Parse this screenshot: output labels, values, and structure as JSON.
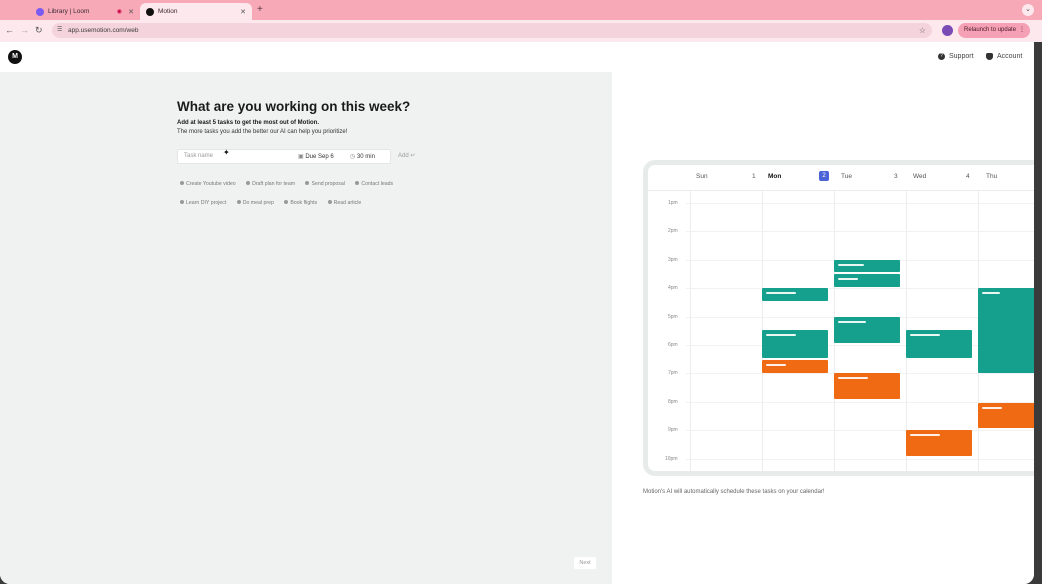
{
  "browser": {
    "tabs": [
      {
        "title": "Library | Loom",
        "active": false
      },
      {
        "title": "Motion",
        "active": true
      }
    ],
    "url": "app.usemotion.com/web",
    "update_label": "Relaunch to update",
    "accent": "#f7a9b8"
  },
  "header": {
    "logo": "M",
    "support_label": "Support",
    "account_label": "Account"
  },
  "onboarding": {
    "title": "What are you working on this week?",
    "subtitle_bold": "Add at least 5 tasks to get the most out of Motion.",
    "subtitle": "The more tasks you add the better our AI can help you prioritize!",
    "task_placeholder": "Task name",
    "due_label": "Due Sep 6",
    "duration_label": "30 min",
    "add_label": "Add",
    "suggestions": [
      "Create Youtube video",
      "Draft plan for team",
      "Send proposal",
      "Contact leads",
      "Learn DIY project",
      "Do meal prep",
      "Book flights",
      "Read article"
    ],
    "next_label": "Next"
  },
  "calendar": {
    "days": [
      {
        "name": "Sun",
        "num": "1",
        "today": false
      },
      {
        "name": "Mon",
        "num": "2",
        "today": true
      },
      {
        "name": "Tue",
        "num": "3",
        "today": false
      },
      {
        "name": "Wed",
        "num": "4",
        "today": false
      },
      {
        "name": "Thu",
        "num": "",
        "today": false
      }
    ],
    "hours": [
      "1pm",
      "2pm",
      "3pm",
      "4pm",
      "5pm",
      "6pm",
      "7pm",
      "8pm",
      "9pm",
      "10pm"
    ],
    "colors": {
      "teal": "#14a08c",
      "orange": "#f06a14",
      "today": "#4a64d8"
    },
    "footnote": "Motion's AI will automatically schedule these tasks on your calendar!"
  }
}
